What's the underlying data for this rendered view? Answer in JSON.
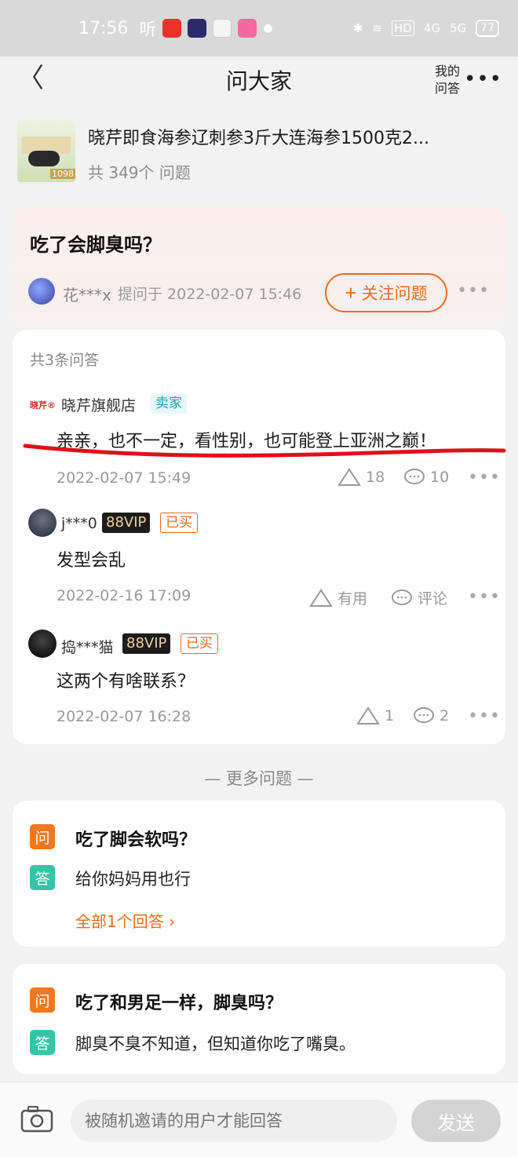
{
  "status_bar": {
    "time": "17:56",
    "listen_text": "听",
    "bt_text": "✱",
    "wifi_text": "≋",
    "hd_text": "HD",
    "signal1": "4G",
    "signal2": "5G",
    "battery": "77"
  },
  "header": {
    "back_glyph": "〈",
    "title": "问大家",
    "my_qa_line1": "我的",
    "my_qa_line2": "问答",
    "more_glyph": "•••"
  },
  "product": {
    "name": "晓芹即食海参辽刺参3斤大连海参1500克2...",
    "count_text": "共 349个 问题",
    "thumb_badge": "1098"
  },
  "question": {
    "title": "吃了会脚臭吗？",
    "asker": "花***x",
    "asked_at": "提问于 2022-02-07 15:46",
    "follow_label": "关注问题",
    "follow_plus": "+",
    "more_glyph": "•••"
  },
  "answers": {
    "total": "共3条问答",
    "items": [
      {
        "store_logo": "晓芹®",
        "user": "晓芹旗舰店",
        "seller_tag": "卖家",
        "text": "亲亲，也不一定，看性别，也可能登上亚洲之巅！",
        "time": "2022-02-07 15:49",
        "likes": "18",
        "comments": "10"
      },
      {
        "user": "j***0",
        "vip": "88VIP",
        "bought": "已买",
        "text": "发型会乱",
        "time": "2022-02-16 17:09",
        "likes": "有用",
        "comments": "评论"
      },
      {
        "user": "捣***猫",
        "vip": "88VIP",
        "bought": "已买",
        "text": "这两个有啥联系？",
        "time": "2022-02-07 16:28",
        "likes": "1",
        "comments": "2"
      }
    ],
    "more_glyph": "•••"
  },
  "more_questions": {
    "title": "—   更多问题   —",
    "q_icon": "问",
    "a_icon": "答",
    "items": [
      {
        "question": "吃了脚会软吗？",
        "answer": "给你妈妈用也行",
        "all_answers": "全部1个回答 ›"
      },
      {
        "question": "吃了和男足一样，脚臭吗？",
        "answer": "脚臭不臭不知道，但知道你吃了嘴臭。"
      }
    ]
  },
  "bottom_bar": {
    "placeholder": "被随机邀请的用户才能回答",
    "send_label": "发送"
  },
  "colors": {
    "accent": "#f26a1b",
    "seller": "#13a9b8",
    "answer_icon": "#35c4a7",
    "question_icon": "#f2771f",
    "highlight_line": "#e0101a"
  }
}
